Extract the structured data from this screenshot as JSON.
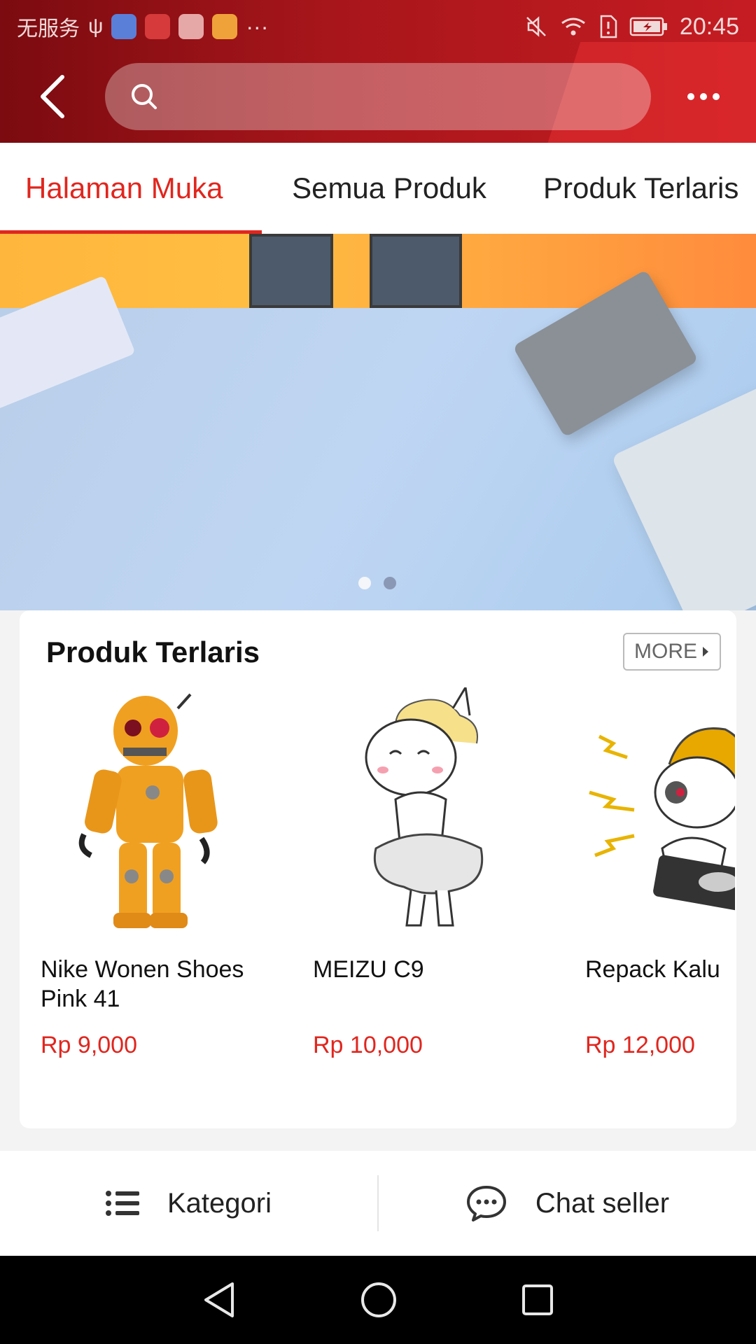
{
  "status_bar": {
    "carrier": "无服务",
    "time": "20:45"
  },
  "search": {
    "placeholder": "",
    "value": ""
  },
  "tabs": [
    {
      "label": "Halaman Muka",
      "active": true
    },
    {
      "label": "Semua Produk",
      "active": false
    },
    {
      "label": "Produk Terlaris",
      "active": false
    }
  ],
  "banner": {
    "slide_count": 2,
    "active_slide": 2
  },
  "best_sellers": {
    "title": "Produk Terlaris",
    "more_label": "MORE",
    "products": [
      {
        "name": "Nike Wonen Shoes Pink 41",
        "price": "Rp 9,000",
        "image": "robot-toy"
      },
      {
        "name": "MEIZU C9",
        "price": "Rp 10,000",
        "image": "unicorn-sticker"
      },
      {
        "name": "Repack Kalu",
        "price": "Rp 12,000",
        "image": "unicorn-dj-sticker"
      }
    ]
  },
  "actions": {
    "category_label": "Kategori",
    "chat_label": "Chat seller"
  },
  "colors": {
    "accent": "#e0261e",
    "header_dark": "#7b0b10",
    "header_light": "#c51c22"
  }
}
